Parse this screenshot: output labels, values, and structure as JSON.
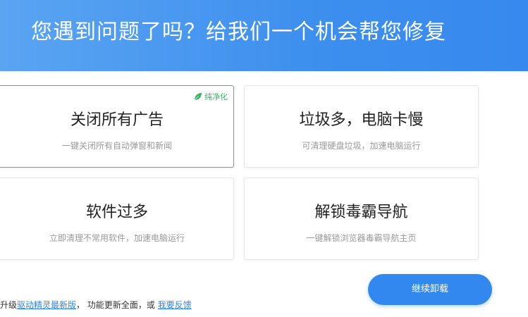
{
  "header": {
    "title": "您遇到问题了吗？给我们一个机会帮您修复"
  },
  "options": [
    {
      "title": "关闭所有广告",
      "desc": "一键关闭所有自动弹窗和新闻",
      "badge": "纯净化",
      "selected": true
    },
    {
      "title": "垃圾多，电脑卡慢",
      "desc": "可清理硬盘垃圾，加速电脑运行"
    },
    {
      "title": "软件过多",
      "desc": "立即清理不常用软件，加速电脑运行"
    },
    {
      "title": "解锁毒霸导航",
      "desc": "一键解锁浏览器毒霸导航主页"
    }
  ],
  "footer": {
    "prefix": "升级",
    "upgrade_link": "驱动精灵最新版",
    "middle": "，  功能更新全面，或",
    "feedback_link": "我要反馈"
  },
  "continue_button": "继续卸载",
  "colors": {
    "accent": "#3288ee",
    "badge_green": "#3cb36a"
  },
  "icons": {
    "badge_icon": "leaf-icon"
  }
}
